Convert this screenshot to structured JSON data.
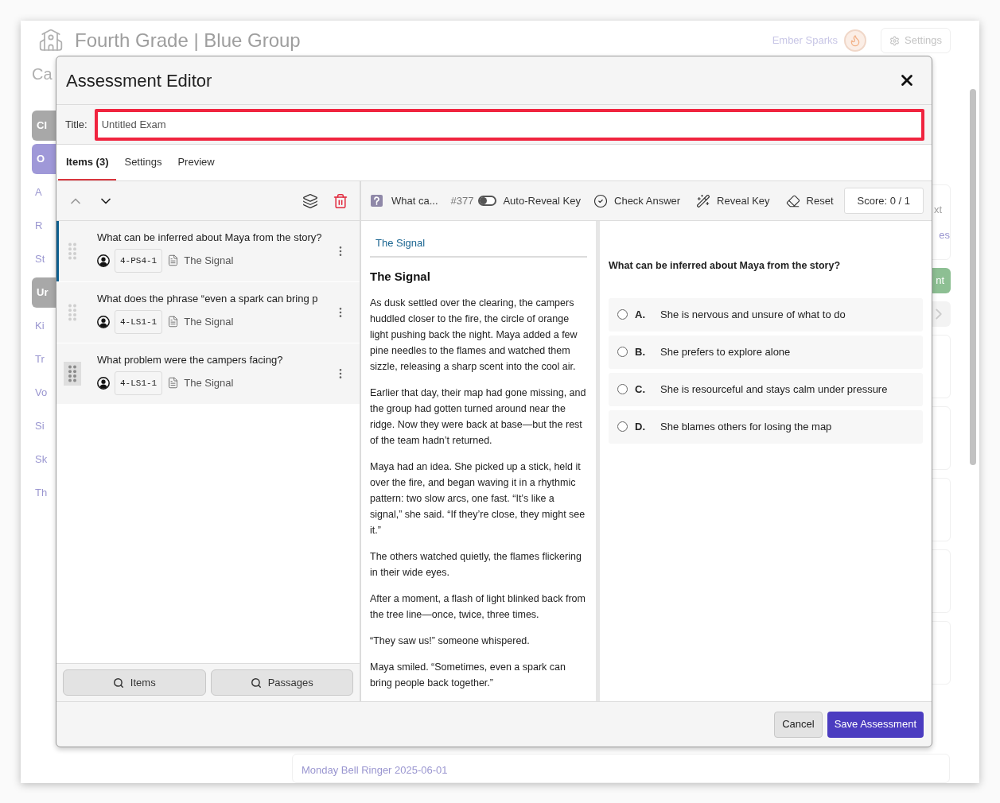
{
  "background": {
    "title": "Fourth Grade | Blue Group",
    "subtitle": "Ca",
    "user": "Ember Sparks",
    "settings": "Settings",
    "left_fragments": [
      {
        "text": "Cl",
        "kind": "pill"
      },
      {
        "text": "O",
        "kind": "accent-pill"
      },
      {
        "text": "A",
        "kind": "link"
      },
      {
        "text": "R",
        "kind": "link"
      },
      {
        "text": "St",
        "kind": "link"
      },
      {
        "text": "Ur",
        "kind": "pill"
      },
      {
        "text": "Ki",
        "kind": "link"
      },
      {
        "text": "Tr",
        "kind": "link"
      },
      {
        "text": "Vo",
        "kind": "link"
      },
      {
        "text": "Si",
        "kind": "link"
      },
      {
        "text": "Sk",
        "kind": "link"
      },
      {
        "text": "Th",
        "kind": "link"
      }
    ],
    "right_fragments": [
      {
        "text": "xt",
        "kind": "text"
      },
      {
        "text": "es",
        "kind": "link"
      },
      {
        "text": "nt",
        "kind": "green-pill"
      }
    ],
    "bottom_card": "Monday Bell Ringer 2025-06-01"
  },
  "dialog": {
    "title": "Assessment Editor",
    "title_label": "Title:",
    "title_value": "Untitled Exam",
    "tabs": [
      {
        "label": "Items (3)",
        "selected": true
      },
      {
        "label": "Settings",
        "selected": false
      },
      {
        "label": "Preview",
        "selected": false
      }
    ],
    "items": [
      {
        "question": "What can be inferred about Maya from the story?",
        "standard": "4-PS4-1",
        "passage": "The Signal",
        "selected": true,
        "hovered": false
      },
      {
        "question": "What does the phrase “even a spark can bring p",
        "standard": "4-LS1-1",
        "passage": "The Signal",
        "selected": false,
        "hovered": false
      },
      {
        "question": "What problem were the campers facing?",
        "standard": "4-LS1-1",
        "passage": "The Signal",
        "selected": false,
        "hovered": true
      }
    ],
    "search_buttons": [
      "Items",
      "Passages"
    ],
    "toolbar": {
      "question": "What ca...",
      "number": "#377",
      "auto_reveal": {
        "label": "Auto-Reveal Key",
        "on": false
      },
      "check": "Check Answer",
      "reveal": "Reveal Key",
      "reset": "Reset",
      "score": "Score: 0 / 1"
    },
    "passage": {
      "link": "The Signal",
      "heading": "The Signal",
      "paragraphs": [
        "As dusk settled over the clearing, the campers huddled closer to the fire, the circle of orange light pushing back the night. Maya added a few pine needles to the flames and watched them sizzle, releasing a sharp scent into the cool air.",
        "Earlier that day, their map had gone missing, and the group had gotten turned around near the ridge. Now they were back at base—but the rest of the team hadn’t returned.",
        "Maya had an idea. She picked up a stick, held it over the fire, and began waving it in a rhythmic pattern: two slow arcs, one fast. “It’s like a signal,” she said. “If they’re close, they might see it.”",
        "The others watched quietly, the flames flickering in their wide eyes.",
        "After a moment, a flash of light blinked back from the tree line—once, twice, three times.",
        "“They saw us!” someone whispered.",
        "Maya smiled. “Sometimes, even a spark can bring people back together.”"
      ]
    },
    "question": {
      "prompt": "What can be inferred about Maya from the story?",
      "choices": [
        {
          "letter": "A.",
          "text": "She is nervous and unsure of what to do",
          "selected": false
        },
        {
          "letter": "B.",
          "text": "She prefers to explore alone",
          "selected": false
        },
        {
          "letter": "C.",
          "text": "She is resourceful and stays calm under pressure",
          "selected": false
        },
        {
          "letter": "D.",
          "text": "She blames others for losing the map",
          "selected": false
        }
      ]
    },
    "buttons": {
      "cancel": "Cancel",
      "save": "Save Assessment"
    }
  }
}
